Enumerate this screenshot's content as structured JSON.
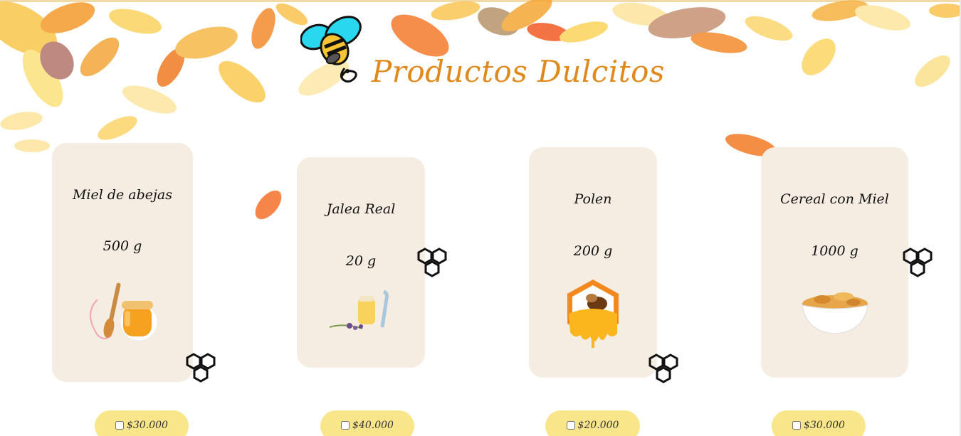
{
  "brand": {
    "title": "Productos Dulcitos"
  },
  "products": [
    {
      "name": "Miel de abejas",
      "weight": "500 g",
      "price": "$30.000",
      "icon": "honey-jar-icon"
    },
    {
      "name": "Jalea Real",
      "weight": "20 g",
      "price": "$40.000",
      "icon": "royal-jelly-icon"
    },
    {
      "name": "Polen",
      "weight": "200 g",
      "price": "$20.000",
      "icon": "bee-honey-badge-icon"
    },
    {
      "name": "Cereal con Miel",
      "weight": "1000 g",
      "price": "$30.000",
      "icon": "cereal-bowl-icon"
    }
  ],
  "colors": {
    "card_bg": "#f5ece2",
    "price_pill": "#f9e68b",
    "brand_orange": "#e08a1e",
    "bee_cyan": "#29d8ef",
    "bee_yellow": "#f7c531"
  }
}
